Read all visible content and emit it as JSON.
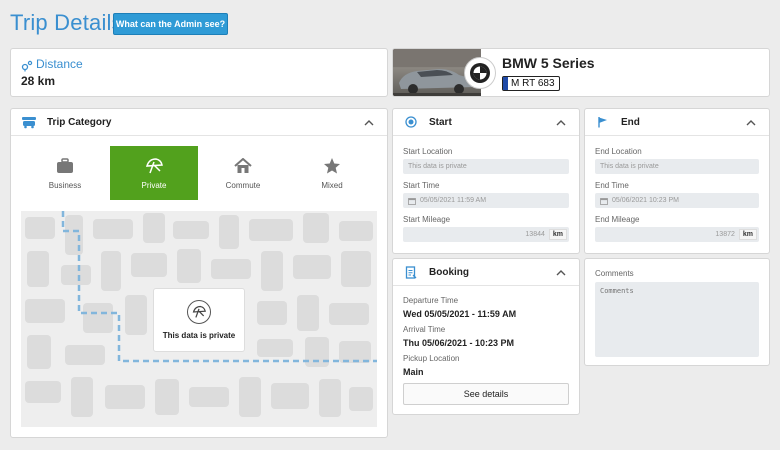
{
  "header": {
    "title": "Trip Details",
    "admin_button": "What can the Admin see?"
  },
  "distance": {
    "label": "Distance",
    "value": "28 km"
  },
  "vehicle": {
    "name": "BMW 5 Series",
    "plate": "M RT 683"
  },
  "category": {
    "title": "Trip Category",
    "options": [
      {
        "label": "Business",
        "icon": "briefcase-icon"
      },
      {
        "label": "Private",
        "icon": "umbrella-icon"
      },
      {
        "label": "Commute",
        "icon": "house-icon"
      },
      {
        "label": "Mixed",
        "icon": "star-icon"
      }
    ],
    "selected": "Private",
    "map_overlay_text": "This data is private"
  },
  "start": {
    "title": "Start",
    "location_label": "Start Location",
    "location_value": "This data is private",
    "time_label": "Start Time",
    "time_value": "05/05/2021 11:59 AM",
    "mileage_label": "Start Mileage",
    "mileage_value": "13844",
    "mileage_unit": "km"
  },
  "end": {
    "title": "End",
    "location_label": "End Location",
    "location_value": "This data is private",
    "time_label": "End Time",
    "time_value": "05/06/2021 10:23 PM",
    "mileage_label": "End Mileage",
    "mileage_value": "13872",
    "mileage_unit": "km"
  },
  "booking": {
    "title": "Booking",
    "departure_label": "Departure Time",
    "departure_value": "Wed 05/05/2021 - 11:59 AM",
    "arrival_label": "Arrival Time",
    "arrival_value": "Thu 05/06/2021 - 10:23 PM",
    "pickup_label": "Pickup Location",
    "pickup_value": "Main",
    "details_button": "See details"
  },
  "comments": {
    "label": "Comments",
    "placeholder": "Comments"
  },
  "colors": {
    "accent": "#3a8fd0",
    "selected": "#52a11d",
    "button": "#2f9bd6"
  }
}
